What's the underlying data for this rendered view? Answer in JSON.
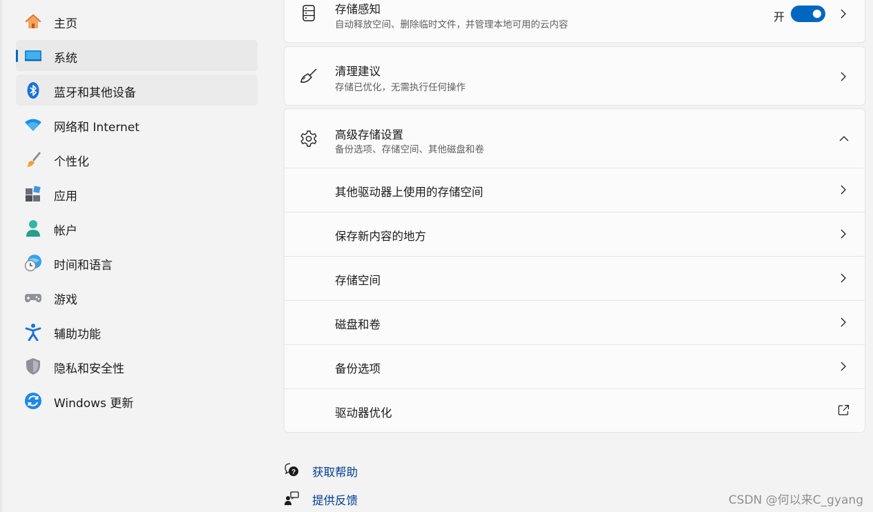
{
  "sidebar": {
    "items": [
      {
        "label": "主页",
        "icon": "home-icon"
      },
      {
        "label": "系统",
        "icon": "system-icon"
      },
      {
        "label": "蓝牙和其他设备",
        "icon": "bluetooth-icon"
      },
      {
        "label": "网络和 Internet",
        "icon": "wifi-icon"
      },
      {
        "label": "个性化",
        "icon": "brush-icon"
      },
      {
        "label": "应用",
        "icon": "apps-icon"
      },
      {
        "label": "帐户",
        "icon": "account-icon"
      },
      {
        "label": "时间和语言",
        "icon": "globe-clock-icon"
      },
      {
        "label": "游戏",
        "icon": "gamepad-icon"
      },
      {
        "label": "辅助功能",
        "icon": "accessibility-icon"
      },
      {
        "label": "隐私和安全性",
        "icon": "shield-icon"
      },
      {
        "label": "Windows 更新",
        "icon": "update-icon"
      }
    ]
  },
  "storage_sense": {
    "title": "存储感知",
    "subtitle": "自动释放空间、删除临时文件，并管理本地可用的云内容",
    "toggle_label": "开",
    "toggle_on": true
  },
  "cleanup": {
    "title": "清理建议",
    "subtitle": "存储已优化，无需执行任何操作"
  },
  "advanced": {
    "title": "高级存储设置",
    "subtitle": "备份选项、存储空间、其他磁盘和卷",
    "expanded": true,
    "rows": [
      {
        "label": "其他驱动器上使用的存储空间",
        "icon": "chevron-right-icon"
      },
      {
        "label": "保存新内容的地方",
        "icon": "chevron-right-icon"
      },
      {
        "label": "存储空间",
        "icon": "chevron-right-icon"
      },
      {
        "label": "磁盘和卷",
        "icon": "chevron-right-icon"
      },
      {
        "label": "备份选项",
        "icon": "chevron-right-icon"
      },
      {
        "label": "驱动器优化",
        "icon": "external-link-icon"
      }
    ]
  },
  "footer": {
    "help": "获取帮助",
    "feedback": "提供反馈"
  },
  "watermark": "CSDN @何以来C_gyang",
  "colors": {
    "accent": "#0067c0",
    "link": "#003e92",
    "background": "#f3f3f3",
    "card": "#fbfbfb"
  }
}
